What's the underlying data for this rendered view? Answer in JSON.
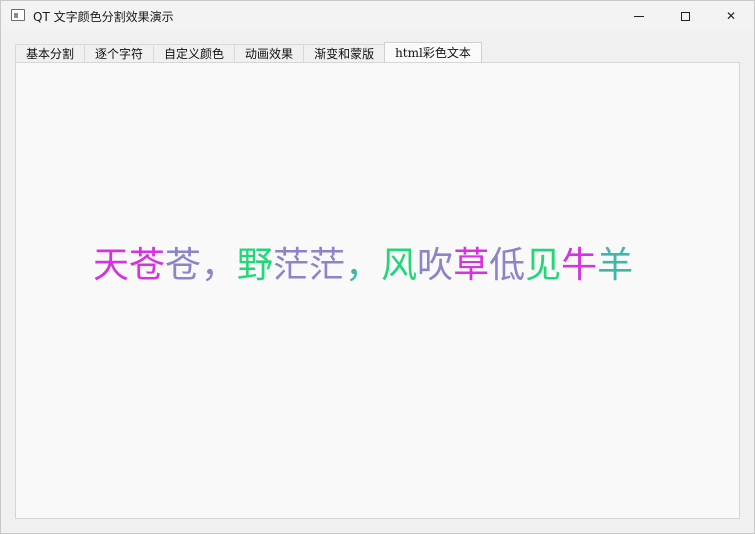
{
  "window": {
    "title": "QT 文字颜色分割效果演示",
    "buttons": {
      "minimize": "minimize-icon",
      "maximize": "maximize-icon",
      "close": "close-icon",
      "close_glyph": "✕"
    }
  },
  "tabs": [
    {
      "label": "基本分割",
      "active": false
    },
    {
      "label": "逐个字符",
      "active": false
    },
    {
      "label": "自定义颜色",
      "active": false
    },
    {
      "label": "动画效果",
      "active": false
    },
    {
      "label": "渐变和蒙版",
      "active": false
    },
    {
      "label": "html彩色文本",
      "active": true
    }
  ],
  "content": {
    "segments": [
      {
        "text": "天苍",
        "color": "#d632e0"
      },
      {
        "text": "苍，",
        "color": "#8a84c8"
      },
      {
        "text": "野",
        "color": "#23d67a"
      },
      {
        "text": "茫茫",
        "color": "#8a84c8"
      },
      {
        "text": "，",
        "color": "#3fb6a8"
      },
      {
        "text": "风",
        "color": "#23d67a"
      },
      {
        "text": "吹",
        "color": "#8a84c8"
      },
      {
        "text": "草",
        "color": "#d632e0"
      },
      {
        "text": "低",
        "color": "#8a84c8"
      },
      {
        "text": "见",
        "color": "#23d67a"
      },
      {
        "text": "牛",
        "color": "#d632e0"
      },
      {
        "text": "羊",
        "color": "#3fb6a8"
      }
    ]
  }
}
